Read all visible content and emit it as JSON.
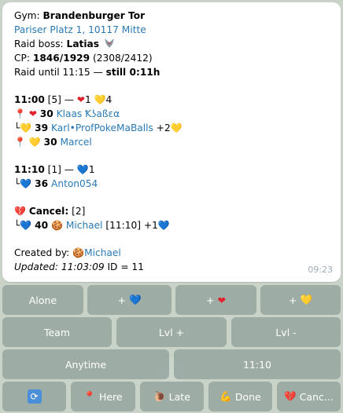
{
  "message": {
    "gym_prefix": "Gym: ",
    "gym_name": "Brandenburger Tor",
    "address": "Pariser Platz 1, 10117 Mitte",
    "boss_prefix": "Raid boss: ",
    "boss_name": "Latias",
    "cp_prefix": "CP: ",
    "cp_main": "1846/1929",
    "cp_extra": " (2308/2412)",
    "raid_until": "Raid until 11:15 — ",
    "still": "still 0:11h",
    "slot1": {
      "time": "11:00",
      "count": " [5] — ",
      "red_count": "1",
      "yellow_count": "4",
      "participants": [
        {
          "prefix_icon": "📍",
          "heart": "❤",
          "heart_class": "heart-red",
          "level": "30",
          "name": "Klaas Ꝁʖaßεα",
          "suffix": ""
        },
        {
          "prefix_icon": "└",
          "heart": "💛",
          "heart_class": "heart-yellow",
          "level": "39",
          "name": "Karl•ProfPokeMaBalls",
          "suffix": " +2"
        },
        {
          "prefix_icon": "📍",
          "heart": "💛",
          "heart_class": "heart-yellow",
          "level": "30",
          "name": "Marcel",
          "suffix": ""
        }
      ]
    },
    "slot2": {
      "time": "11:10",
      "count": " [1] — ",
      "blue_count": "1",
      "participant": {
        "prefix_icon": "└",
        "level": "36",
        "name": "Anton054"
      }
    },
    "cancel": {
      "label": "Cancel:",
      "count": " [2]",
      "participant": {
        "prefix_icon": "└",
        "level": "40",
        "name": "Michael",
        "time": " [11:10]",
        "extra": " +1"
      }
    },
    "created_prefix": "Created by: ",
    "created_by": "Michael",
    "updated_label": "Updated: 11:03:09",
    "id_text": " ID = 11",
    "timestamp": "09:23"
  },
  "keyboard": {
    "alone": "Alone",
    "plus_blue": "+",
    "plus_red": "+",
    "plus_yellow": "+",
    "team": "Team",
    "lvl_plus": "Lvl +",
    "lvl_minus": "Lvl -",
    "anytime": "Anytime",
    "time_1110": "11:10",
    "here": "Here",
    "late": "Late",
    "done": "Done",
    "cancel": "Canc..."
  },
  "colors": {
    "link": "#2a7ab5",
    "button_bg": "#7a8c8a",
    "chat_bg": "#c9d3c8"
  }
}
